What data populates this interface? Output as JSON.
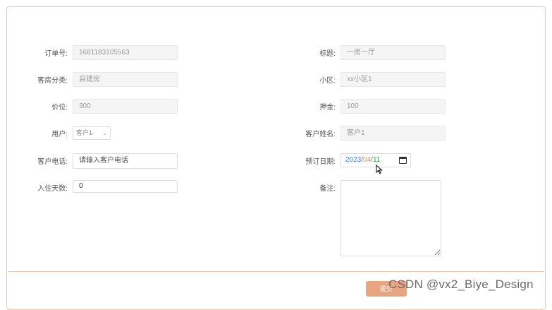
{
  "form": {
    "order_no": {
      "label": "订单号:",
      "value": "1681183105563"
    },
    "title": {
      "label": "标题:",
      "value": "一房一厅"
    },
    "room_type": {
      "label": "客房分类:",
      "value": "自建房"
    },
    "community": {
      "label": "小区:",
      "value": "xx小区1"
    },
    "price": {
      "label": "价位:",
      "value": "300"
    },
    "deposit": {
      "label": "押金:",
      "value": "100"
    },
    "user": {
      "label": "用户:",
      "value": "客户1-"
    },
    "customer_name": {
      "label": "客户姓名:",
      "value": "客户1"
    },
    "customer_phone": {
      "label": "客户电话:",
      "placeholder": "请输入客户电话"
    },
    "booking_date": {
      "label": "预订日期:",
      "year": "2023",
      "month": "04",
      "day": "11",
      "separator": "/"
    },
    "stay_days": {
      "label": "入住天数:",
      "value": "0"
    },
    "remark": {
      "label": "备注:"
    }
  },
  "footer": {
    "submit_label": "提交"
  },
  "watermark": "CSDN @vx2_Biye_Design",
  "icons": {
    "select_chevron": "chevron-down-icon",
    "date_picker": "calendar-icon",
    "pointer": "mouse-cursor-icon"
  },
  "colors": {
    "accent": "#e8a582",
    "border": "#f0c8a8"
  }
}
